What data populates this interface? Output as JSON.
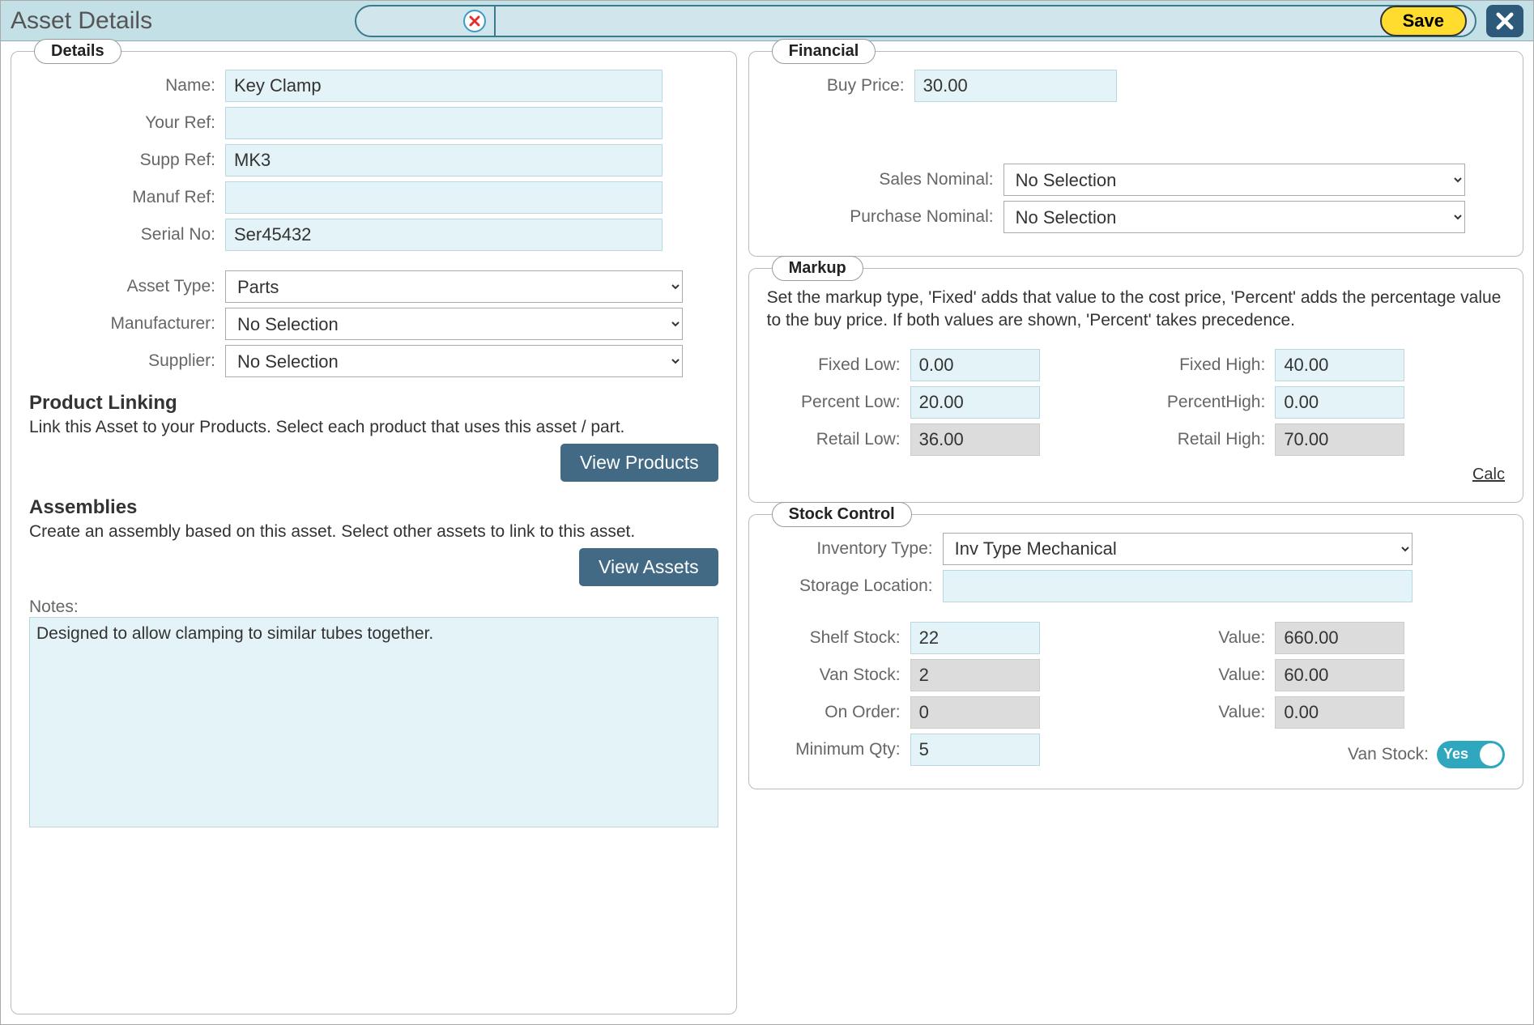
{
  "header": {
    "title": "Asset Details",
    "save_label": "Save"
  },
  "details": {
    "legend": "Details",
    "name_label": "Name:",
    "name_value": "Key Clamp",
    "your_ref_label": "Your Ref:",
    "your_ref_value": "",
    "supp_ref_label": "Supp Ref:",
    "supp_ref_value": "MK3",
    "manuf_ref_label": "Manuf Ref:",
    "manuf_ref_value": "",
    "serial_label": "Serial No:",
    "serial_value": "Ser45432",
    "asset_type_label": "Asset Type:",
    "asset_type_value": "Parts",
    "manufacturer_label": "Manufacturer:",
    "manufacturer_value": "No Selection",
    "supplier_label": "Supplier:",
    "supplier_value": "No Selection",
    "product_linking_title": "Product Linking",
    "product_linking_text": "Link this Asset to your Products. Select each product that uses this asset / part.",
    "view_products_label": "View Products",
    "assemblies_title": "Assemblies",
    "assemblies_text": "Create an assembly based on this asset. Select other assets to link to this asset.",
    "view_assets_label": "View Assets",
    "notes_label": "Notes:",
    "notes_value": "Designed to allow clamping to similar tubes together."
  },
  "financial": {
    "legend": "Financial",
    "buy_price_label": "Buy Price:",
    "buy_price_value": "30.00",
    "sales_nominal_label": "Sales Nominal:",
    "sales_nominal_value": "No Selection",
    "purchase_nominal_label": "Purchase Nominal:",
    "purchase_nominal_value": "No Selection"
  },
  "markup": {
    "legend": "Markup",
    "description": "Set the markup type, 'Fixed' adds that value to the cost price, 'Percent' adds the percentage value to the buy price. If both values are shown, 'Percent' takes precedence.",
    "fixed_low_label": "Fixed Low:",
    "fixed_low_value": "0.00",
    "fixed_high_label": "Fixed High:",
    "fixed_high_value": "40.00",
    "percent_low_label": "Percent Low:",
    "percent_low_value": "20.00",
    "percent_high_label": "PercentHigh:",
    "percent_high_value": "0.00",
    "retail_low_label": "Retail Low:",
    "retail_low_value": "36.00",
    "retail_high_label": "Retail High:",
    "retail_high_value": "70.00",
    "calc_label": "Calc"
  },
  "stock": {
    "legend": "Stock Control",
    "inventory_type_label": "Inventory Type:",
    "inventory_type_value": "Inv Type Mechanical",
    "storage_location_label": "Storage Location:",
    "storage_location_value": "",
    "shelf_stock_label": "Shelf Stock:",
    "shelf_stock_value": "22",
    "shelf_value_label": "Value:",
    "shelf_value_value": "660.00",
    "van_stock_label": "Van Stock:",
    "van_stock_value": "2",
    "van_value_label": "Value:",
    "van_value_value": "60.00",
    "on_order_label": "On Order:",
    "on_order_value": "0",
    "on_order_value_label": "Value:",
    "on_order_value_value": "0.00",
    "min_qty_label": "Minimum Qty:",
    "min_qty_value": "5",
    "van_stock_toggle_label": "Van Stock:",
    "van_stock_toggle_value": "Yes"
  }
}
